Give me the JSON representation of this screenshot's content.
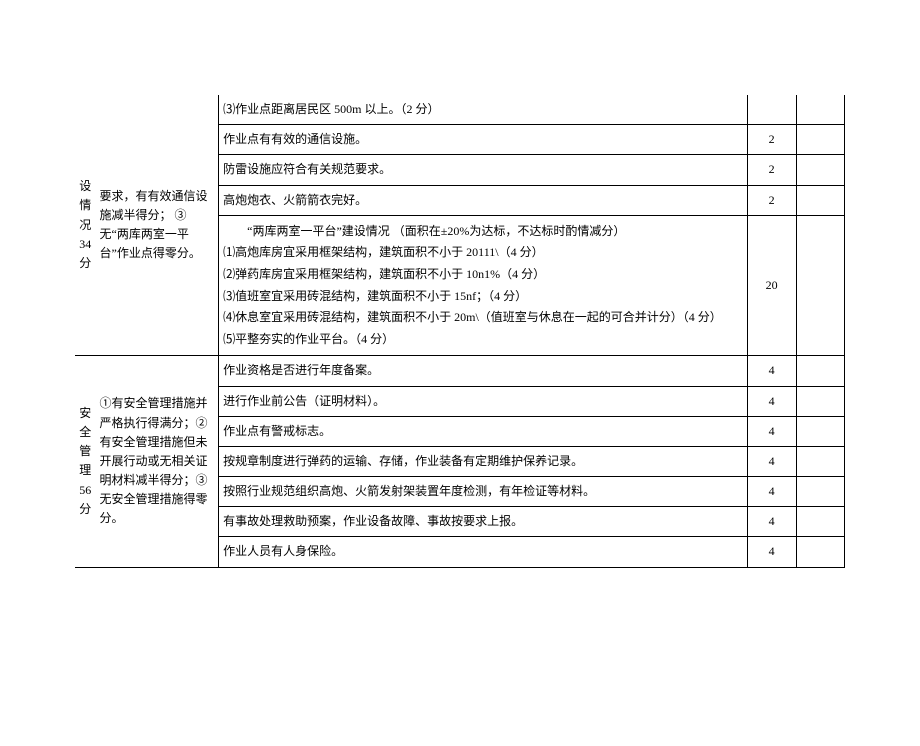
{
  "section1": {
    "category": "设 情 况 34 分",
    "desc_part1": "要求，有有效通信设施减半得分；",
    "desc_part2": "③无“两库两室一平台”作业点得零分。",
    "rows": {
      "r1_item": "⑶作业点距离居民区 500m 以上。（2 分）",
      "r2_item": "作业点有有效的通信设施。",
      "r2_score": "2",
      "r3_item": "防雷设施应符合有关规范要求。",
      "r3_score": "2",
      "r4_item": "高炮炮衣、火箭箭衣完好。",
      "r4_score": "2",
      "r5_line1": "“两库两室一平台”建设情况 （面积在±20%为达标，不达标时酌情减分）",
      "r5_line2": "⑴高炮库房宜采用框架结构，建筑面积不小于 20111\\（4 分）",
      "r5_line3": "⑵弹药库房宜采用框架结构，建筑面积不小于 10n1%（4 分）",
      "r5_line4": "⑶值班室宜采用砖混结构，建筑面积不小于 15nf；（4 分）",
      "r5_line5": "⑷休息室宜采用砖混结构，建筑面积不小于 20m\\（值班室与休息在一起的可合并计分）（4 分）",
      "r5_line6": "⑸平整夯实的作业平台。（4 分）",
      "r5_score": "20"
    }
  },
  "section2": {
    "category": "安 全 管 理 56 分",
    "desc": "①有安全管理措施并严格执行得满分；②有安全管理措施但未开展行动或无相关证明材料减半得分；③无安全管理措施得零分。",
    "rows": {
      "r1_item": "作业资格是否进行年度备案。",
      "r1_score": "4",
      "r2_item": "进行作业前公告（证明材料）。",
      "r2_score": "4",
      "r3_item": "作业点有警戒标志。",
      "r3_score": "4",
      "r4_item": "按规章制度进行弹药的运输、存储，作业装备有定期维护保养记录。",
      "r4_score": "4",
      "r5_item": "按照行业规范组织高炮、火箭发射架装置年度检测，有年检证等材料。",
      "r5_score": "4",
      "r6_item": "有事故处理救助预案，作业设备故障、事故按要求上报。",
      "r6_score": "4",
      "r7_item": "作业人员有人身保险。",
      "r7_score": "4"
    }
  }
}
